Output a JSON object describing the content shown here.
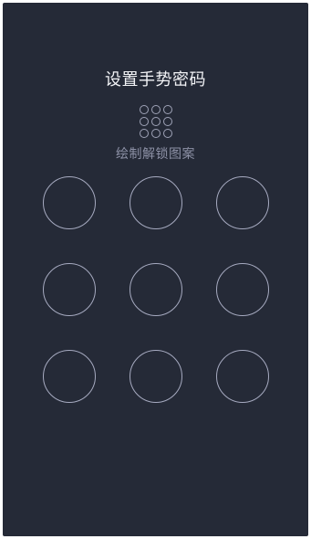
{
  "screen": {
    "title": "设置手势密码",
    "subtitle": "绘制解锁图案",
    "background_color": "#252a37",
    "ring_color": "#a6aac0"
  },
  "preview_icon": "pattern-grid-icon",
  "pattern_nodes": [
    {
      "id": 1
    },
    {
      "id": 2
    },
    {
      "id": 3
    },
    {
      "id": 4
    },
    {
      "id": 5
    },
    {
      "id": 6
    },
    {
      "id": 7
    },
    {
      "id": 8
    },
    {
      "id": 9
    }
  ]
}
